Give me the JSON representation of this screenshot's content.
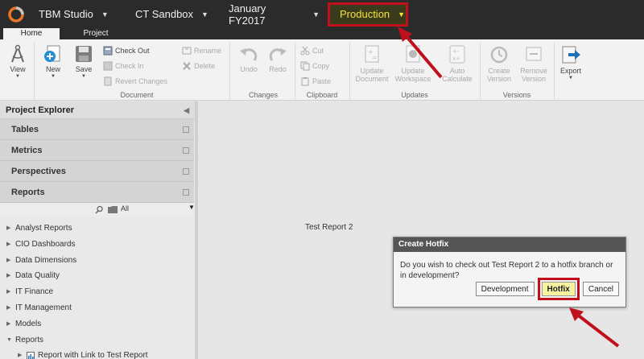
{
  "topbar": {
    "studio": "TBM Studio",
    "sandbox": "CT Sandbox",
    "period": "January FY2017",
    "production": "Production",
    "accent": "#f4e13a",
    "highlight": "#c0101c"
  },
  "tabs": {
    "home": "Home",
    "project": "Project"
  },
  "ribbon": {
    "view": "View",
    "new": "New",
    "save": "Save",
    "check_out": "Check Out",
    "check_in": "Check In",
    "revert": "Revert Changes",
    "rename": "Rename",
    "delete": "Delete",
    "undo": "Undo",
    "redo": "Redo",
    "cut": "Cut",
    "copy": "Copy",
    "paste": "Paste",
    "update_document": [
      "Update",
      "Document"
    ],
    "update_workspace": [
      "Update",
      "Workspace"
    ],
    "auto_calculate": [
      "Auto",
      "Calculate"
    ],
    "create_version": [
      "Create",
      "Version"
    ],
    "remove_version": [
      "Remove",
      "Version"
    ],
    "export": "Export",
    "groups": {
      "document": "Document",
      "changes": "Changes",
      "clipboard": "Clipboard",
      "updates": "Updates",
      "versions": "Versions"
    }
  },
  "sidebar": {
    "title": "Project Explorer",
    "sections": [
      "Tables",
      "Metrics",
      "Perspectives",
      "Reports"
    ],
    "filter": "All",
    "tree": [
      "Analyst Reports",
      "CIO Dashboards",
      "Data Dimensions",
      "Data Quality",
      "IT Finance",
      "IT Management",
      "Models",
      "Reports"
    ],
    "child": "Report with Link to Test Report"
  },
  "main": {
    "label": "Test Report 2"
  },
  "dialog": {
    "title": "Create Hotfix",
    "message": "Do you wish to check out Test Report 2 to a hotfix branch or in development?",
    "development": "Development",
    "hotfix": "Hotfix",
    "cancel": "Cancel"
  }
}
